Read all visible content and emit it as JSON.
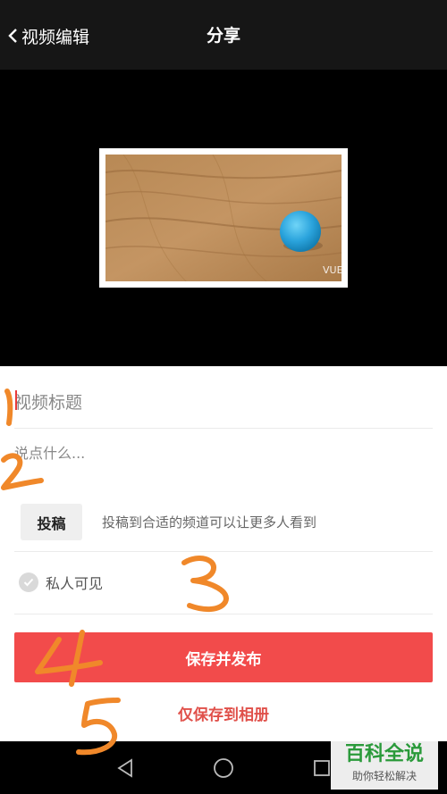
{
  "header": {
    "back_label": "视频编辑",
    "title": "分享"
  },
  "preview": {
    "watermark_text": "VUE"
  },
  "form": {
    "title_placeholder": "视频标题",
    "desc_placeholder": "说点什么...",
    "contribute_label": "投稿",
    "contribute_hint": "投稿到合适的频道可以让更多人看到",
    "private_label": "私人可见",
    "private_checked": false,
    "publish_label": "保存并发布",
    "save_only_label": "仅保存到相册"
  },
  "annotations": [
    "1",
    "2",
    "3",
    "4",
    "5"
  ],
  "watermark": {
    "main": "百科全说",
    "sub": "助你轻松解决"
  },
  "colors": {
    "accent": "#f24b4b",
    "annotation": "#f0882a",
    "watermark_green": "#2a9a3a"
  }
}
